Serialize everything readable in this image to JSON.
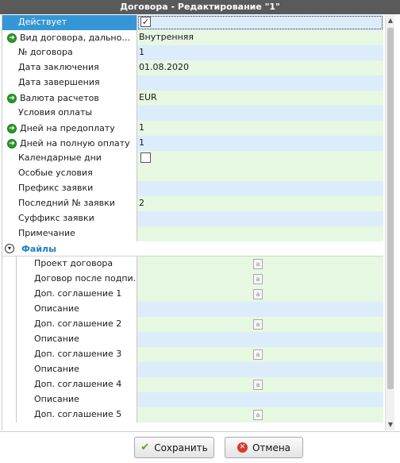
{
  "window": {
    "title": "Договора - Редактирование \"1\""
  },
  "fields": [
    {
      "label": "Действует",
      "value": "",
      "type": "checkbox",
      "checked": true,
      "required": false,
      "selected": true
    },
    {
      "label": "Вид договора, дально...",
      "value": "Внутренняя",
      "required": true
    },
    {
      "label": "№ договора",
      "value": "1",
      "required": false
    },
    {
      "label": "Дата заключения",
      "value": "01.08.2020",
      "required": false
    },
    {
      "label": "Дата завершения",
      "value": "",
      "required": false
    },
    {
      "label": "Валюта расчетов",
      "value": "EUR",
      "required": true
    },
    {
      "label": "Условия оплаты",
      "value": "",
      "required": false
    },
    {
      "label": "Дней на предоплату",
      "value": "1",
      "required": true
    },
    {
      "label": "Дней на полную оплату",
      "value": "1",
      "required": true
    },
    {
      "label": "Календарные дни",
      "value": "",
      "type": "checkbox",
      "checked": false,
      "required": false
    },
    {
      "label": "Особые условия",
      "value": "",
      "required": false
    },
    {
      "label": "Префикс заявки",
      "value": "",
      "required": false
    },
    {
      "label": "Последний № заявки",
      "value": "2",
      "required": false
    },
    {
      "label": "Суффикс заявки",
      "value": "",
      "required": false
    },
    {
      "label": "Примечание",
      "value": "",
      "required": false
    }
  ],
  "files_section": {
    "label": "Файлы",
    "items": [
      {
        "label": "Проект договора",
        "has_file_icon": true
      },
      {
        "label": "Договор после подпи...",
        "has_file_icon": true
      },
      {
        "label": "Доп. соглашение 1",
        "has_file_icon": true
      },
      {
        "label": "Описание",
        "has_file_icon": false
      },
      {
        "label": "Доп. соглашение 2",
        "has_file_icon": true
      },
      {
        "label": "Описание",
        "has_file_icon": false
      },
      {
        "label": "Доп. соглашение 3",
        "has_file_icon": true
      },
      {
        "label": "Описание",
        "has_file_icon": false
      },
      {
        "label": "Доп. соглашение 4",
        "has_file_icon": true
      },
      {
        "label": "Описание",
        "has_file_icon": false
      },
      {
        "label": "Доп. соглашение 5",
        "has_file_icon": true
      }
    ]
  },
  "icons": {
    "required": "green-circle-arrow-icon",
    "file": "file-icon",
    "collapse": "collapse-circle-icon"
  },
  "buttons": {
    "save_label": "Сохранить",
    "cancel_label": "Отмена"
  },
  "colors": {
    "selected": "#3596d5",
    "row_blue": "#dcecfb",
    "row_green": "#e6f7e2",
    "section": "#1e7fc8"
  }
}
